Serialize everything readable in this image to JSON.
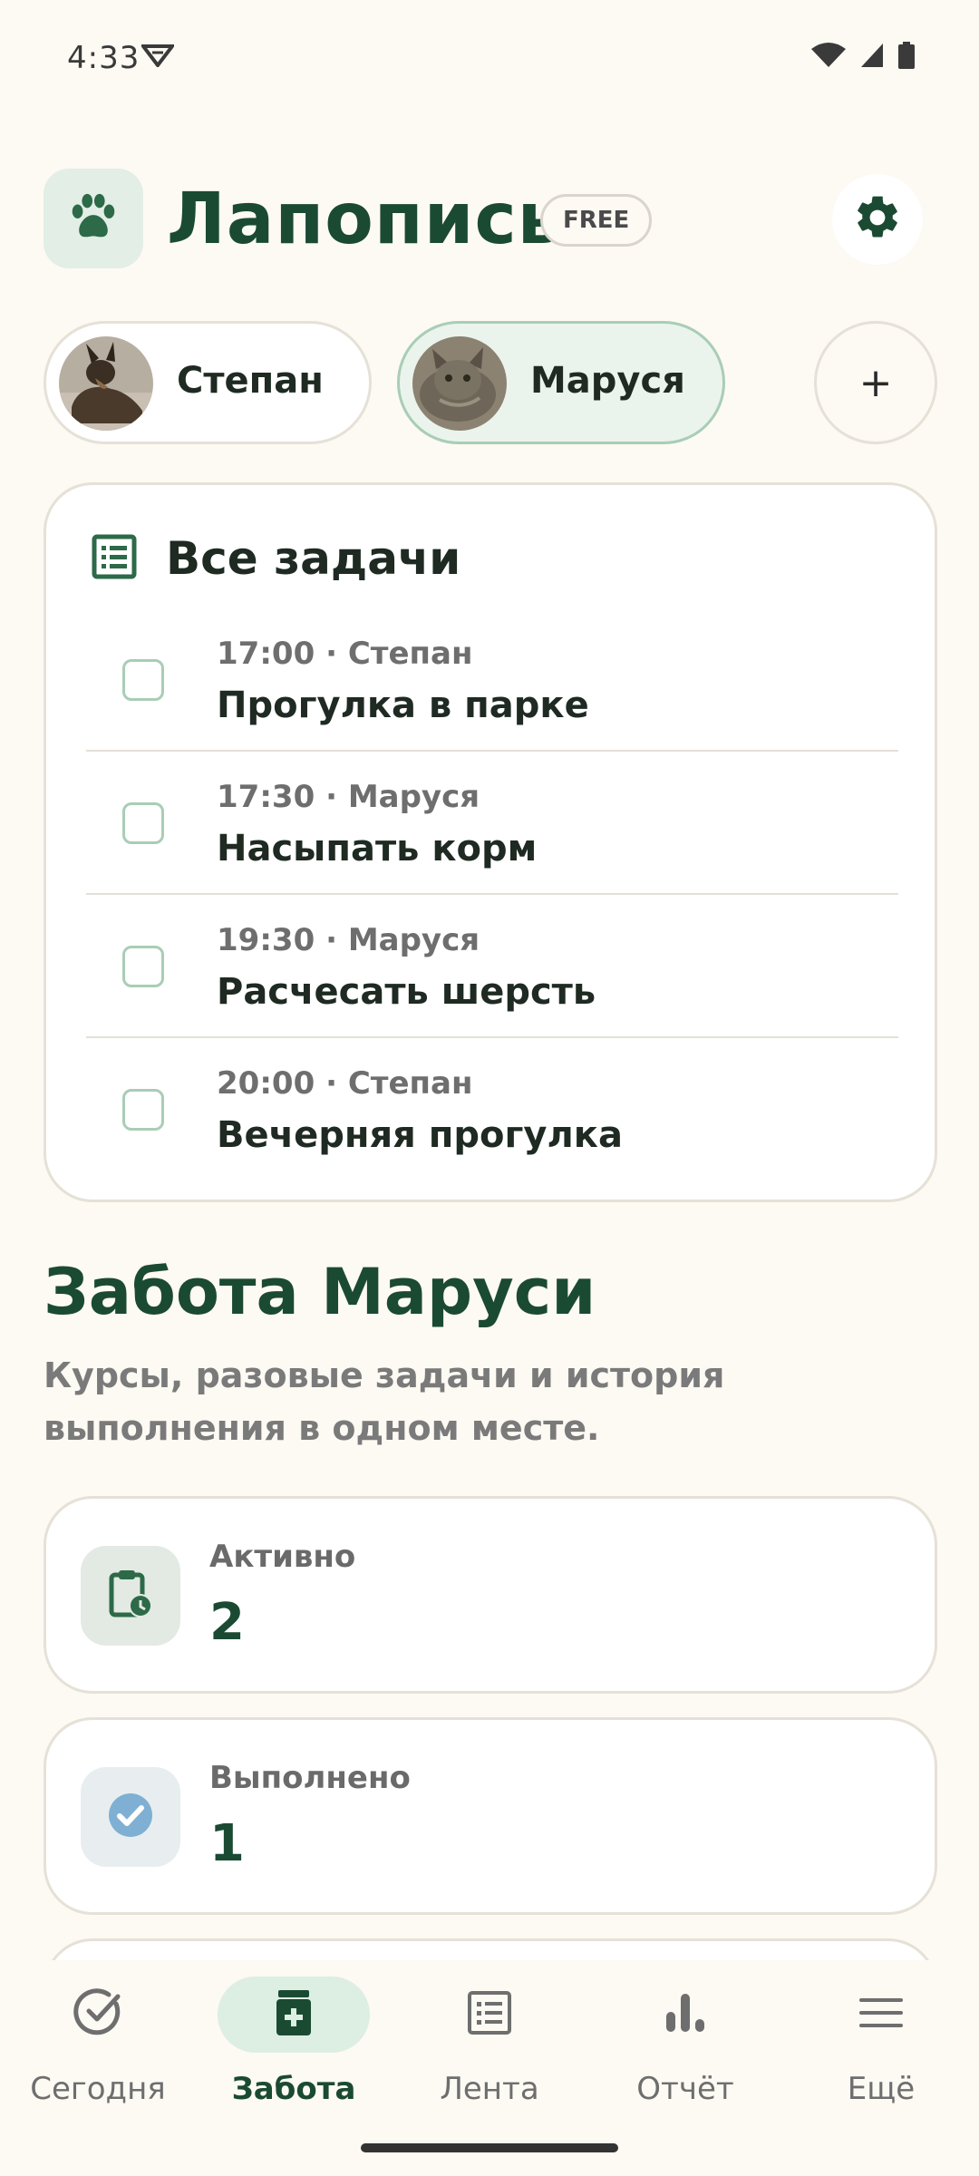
{
  "status_bar": {
    "time": "4:33"
  },
  "header": {
    "app_name": "Лапопись",
    "plan_badge": "FREE"
  },
  "pets": [
    {
      "name": "Степан",
      "selected": false
    },
    {
      "name": "Маруся",
      "selected": true
    }
  ],
  "add_pet_label": "+",
  "tasks": {
    "title": "Все задачи",
    "items": [
      {
        "meta": "17:00 · Степан",
        "title": "Прогулка в парке"
      },
      {
        "meta": "17:30 · Маруся",
        "title": "Насыпать корм"
      },
      {
        "meta": "19:30 · Маруся",
        "title": "Расчесать шерсть"
      },
      {
        "meta": "20:00 · Степан",
        "title": "Вечерняя прогулка"
      }
    ]
  },
  "care": {
    "title": "Забота Маруси",
    "subtitle": "Курсы, разовые задачи и история выполнения в одном месте."
  },
  "stats": [
    {
      "label": "Активно",
      "value": "2",
      "icon": "clipboard-clock-icon"
    },
    {
      "label": "Выполнено",
      "value": "1",
      "icon": "check-circle-icon"
    }
  ],
  "nav": [
    {
      "label": "Сегодня",
      "icon": "check-circle-outline-icon",
      "active": false
    },
    {
      "label": "Забота",
      "icon": "medicine-icon",
      "active": true
    },
    {
      "label": "Лента",
      "icon": "list-icon",
      "active": false
    },
    {
      "label": "Отчёт",
      "icon": "bar-chart-icon",
      "active": false
    },
    {
      "label": "Ещё",
      "icon": "menu-icon",
      "active": false
    }
  ],
  "colors": {
    "brand": "#1B4A33",
    "background": "#FDF9F3",
    "accent_light": "#E2EEE6",
    "done_blue": "#7FB0D3"
  }
}
